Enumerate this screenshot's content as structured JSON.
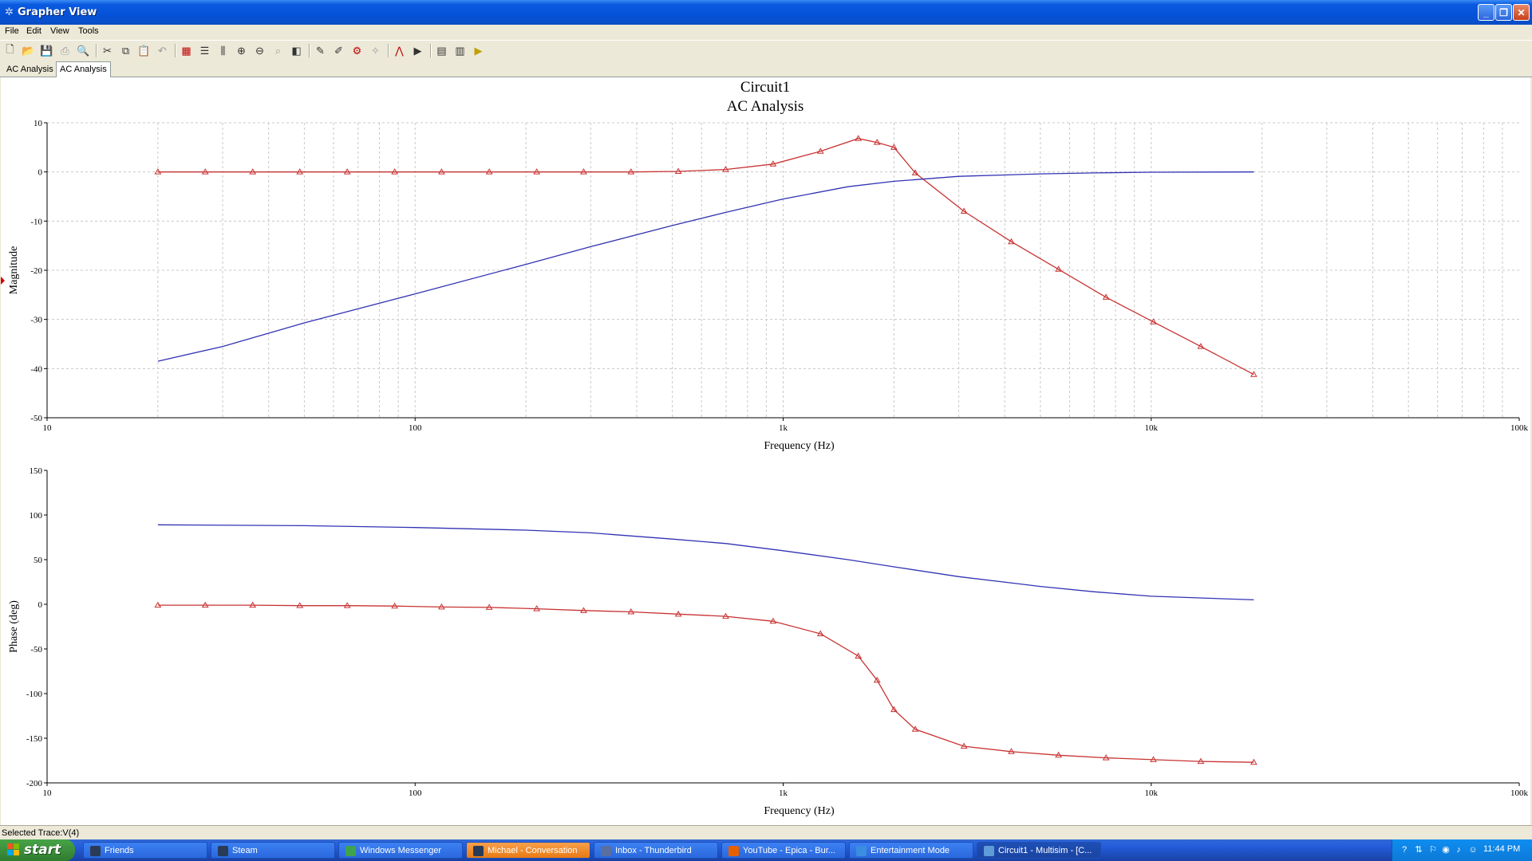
{
  "window": {
    "title": "Grapher View"
  },
  "menu": [
    "File",
    "Edit",
    "View",
    "Tools"
  ],
  "toolbar": [
    {
      "name": "new-icon",
      "glyph": "🗋"
    },
    {
      "name": "open-icon",
      "glyph": "📂"
    },
    {
      "name": "save-icon",
      "glyph": "💾"
    },
    {
      "name": "print-icon",
      "glyph": "⎙",
      "disabled": true
    },
    {
      "name": "print-preview-icon",
      "glyph": "🔍",
      "disabled": true
    },
    {
      "sep": true
    },
    {
      "name": "cut-icon",
      "glyph": "✂"
    },
    {
      "name": "copy-icon",
      "glyph": "⧉"
    },
    {
      "name": "paste-icon",
      "glyph": "📋",
      "disabled": true
    },
    {
      "name": "undo-icon",
      "glyph": "↶",
      "disabled": true
    },
    {
      "sep": true
    },
    {
      "name": "toggle-grid-icon",
      "glyph": "▦",
      "color": "#c00000"
    },
    {
      "name": "toggle-legend-icon",
      "glyph": "☰"
    },
    {
      "name": "cursors-icon",
      "glyph": "⫼"
    },
    {
      "name": "zoom-in-icon",
      "glyph": "⊕"
    },
    {
      "name": "zoom-out-icon",
      "glyph": "⊖"
    },
    {
      "name": "zoom-full-icon",
      "glyph": "⌕",
      "disabled": true
    },
    {
      "name": "reverse-colors-icon",
      "glyph": "◧"
    },
    {
      "sep": true
    },
    {
      "name": "select-marks-icon",
      "glyph": "✎"
    },
    {
      "name": "add-text-icon",
      "glyph": "✐"
    },
    {
      "name": "properties-icon",
      "glyph": "⚙",
      "color": "#c00000"
    },
    {
      "name": "export-icon",
      "glyph": "✧",
      "disabled": true
    },
    {
      "sep": true
    },
    {
      "name": "overlay-traces-icon",
      "glyph": "⋀",
      "color": "#c00000"
    },
    {
      "name": "add-trace-icon",
      "glyph": "▶"
    },
    {
      "sep": true
    },
    {
      "name": "export-excel-icon",
      "glyph": "▤"
    },
    {
      "name": "export-mathcad-icon",
      "glyph": "▥"
    },
    {
      "name": "run-icon",
      "glyph": "▶",
      "color": "#c0a000"
    }
  ],
  "tabs": [
    {
      "label": "AC Analysis",
      "active": false
    },
    {
      "label": "AC Analysis",
      "active": true
    }
  ],
  "chart_data": [
    {
      "type": "line",
      "title": "Circuit1",
      "subtitle": "AC Analysis",
      "xlabel": "Frequency (Hz)",
      "ylabel": "Magnitude",
      "xscale": "log",
      "xlim": [
        10,
        100000
      ],
      "ylim": [
        -50,
        10
      ],
      "xticks": [
        10,
        100,
        1000,
        10000,
        100000
      ],
      "xtick_labels": [
        "10",
        "100",
        "1k",
        "10k",
        "100k"
      ],
      "yticks": [
        10,
        0,
        -10,
        -20,
        -30,
        -40,
        -50
      ],
      "grid": true,
      "series": [
        {
          "color": "#c83232",
          "marker": "triangle",
          "x": [
            20,
            26.9,
            36.2,
            48.6,
            65.4,
            88,
            118,
            159,
            214,
            287,
            386,
            519,
            698,
            939,
            1263,
            1600,
            1800,
            2000,
            2285,
            3100,
            4169,
            5600,
            7540,
            10140,
            13640,
            19000
          ],
          "y": [
            0,
            0,
            0,
            0,
            0,
            0,
            0,
            0,
            0,
            0,
            0,
            0.1,
            0.5,
            1.6,
            4.2,
            6.8,
            6,
            5,
            -0.2,
            -8,
            -14.2,
            -19.8,
            -25.5,
            -30.5,
            -35.5,
            -41.2
          ]
        },
        {
          "color": "#3232b4",
          "marker": "none",
          "x": [
            20,
            30,
            50,
            100,
            200,
            300,
            500,
            700,
            1000,
            1500,
            2000,
            3000,
            5000,
            7000,
            10000,
            19000
          ],
          "y": [
            -38.5,
            -35.5,
            -30.7,
            -24.8,
            -18.8,
            -15.2,
            -10.9,
            -8.2,
            -5.5,
            -3,
            -1.9,
            -0.9,
            -0.4,
            -0.2,
            -0.05,
            0
          ]
        }
      ]
    },
    {
      "type": "line",
      "xlabel": "Frequency (Hz)",
      "ylabel": "Phase (deg)",
      "xscale": "log",
      "xlim": [
        10,
        100000
      ],
      "ylim": [
        -200,
        150
      ],
      "xticks": [
        10,
        100,
        1000,
        10000,
        100000
      ],
      "xtick_labels": [
        "10",
        "100",
        "1k",
        "10k",
        "100k"
      ],
      "yticks": [
        150,
        100,
        50,
        0,
        -50,
        -100,
        -150,
        -200
      ],
      "grid": false,
      "series": [
        {
          "color": "#c83232",
          "marker": "triangle",
          "x": [
            20,
            26.9,
            36.2,
            48.6,
            65.4,
            88,
            118,
            159,
            214,
            287,
            386,
            519,
            698,
            939,
            1263,
            1600,
            1800,
            2000,
            2285,
            3100,
            4169,
            5600,
            7540,
            10140,
            13640,
            19000
          ],
          "y": [
            -1,
            -1,
            -1,
            -1.5,
            -1.5,
            -2,
            -3,
            -3.5,
            -5,
            -7,
            -8.5,
            -11,
            -13.5,
            -19,
            -33,
            -58,
            -85,
            -118,
            -140,
            -159,
            -165,
            -169,
            -172,
            -174,
            -176,
            -177
          ]
        },
        {
          "color": "#3232b4",
          "marker": "none",
          "x": [
            20,
            50,
            100,
            200,
            300,
            500,
            700,
            1000,
            1500,
            2000,
            3000,
            5000,
            7000,
            10000,
            19000
          ],
          "y": [
            89,
            88,
            86,
            83,
            80,
            73,
            68,
            60,
            50,
            42,
            31,
            20,
            14,
            9,
            5
          ]
        }
      ]
    }
  ],
  "status": {
    "text": "Selected Trace:V(4)"
  },
  "taskbar": {
    "start_label": "start",
    "tasks": [
      {
        "label": "Friends",
        "style": "normal",
        "icon": "steam-icon"
      },
      {
        "label": "Steam",
        "style": "normal",
        "icon": "steam-icon"
      },
      {
        "label": "Windows Messenger",
        "style": "normal",
        "icon": "messenger-icon"
      },
      {
        "label": "Michael - Conversation",
        "style": "orange",
        "icon": "steam-icon"
      },
      {
        "label": "Inbox - Thunderbird",
        "style": "normal",
        "icon": "thunderbird-icon"
      },
      {
        "label": "YouTube - Epica - Bur...",
        "style": "normal",
        "icon": "firefox-icon"
      },
      {
        "label": "Entertainment Mode",
        "style": "normal",
        "icon": "app-icon"
      },
      {
        "label": "Circuit1 - Multisim - [C...",
        "style": "active",
        "icon": "multisim-icon"
      }
    ],
    "clock": "11:44 PM"
  }
}
